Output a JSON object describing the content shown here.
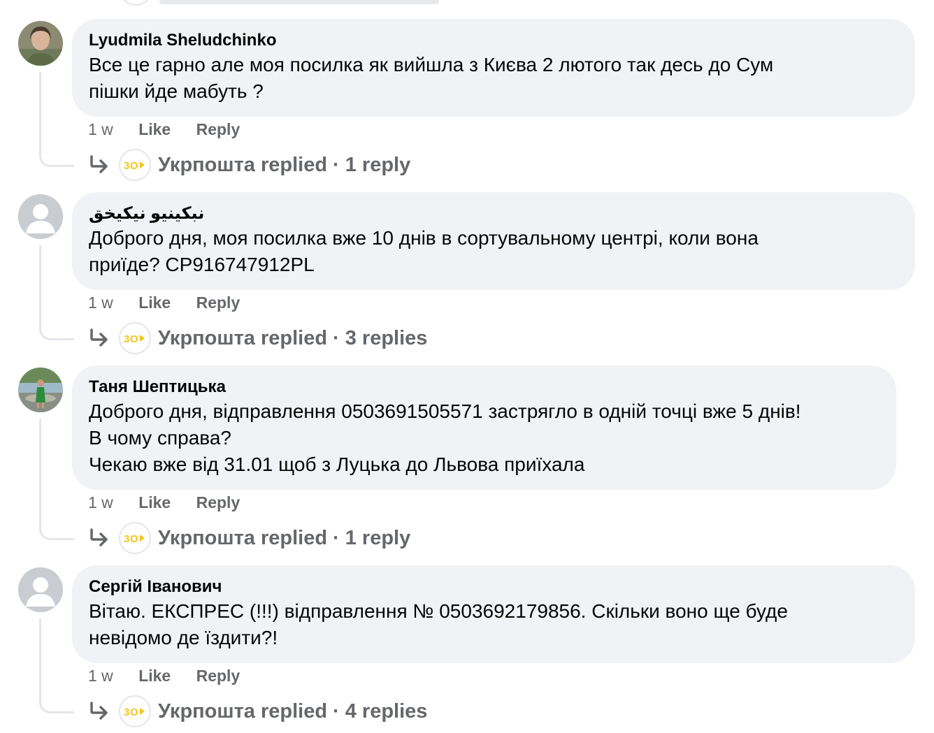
{
  "colors": {
    "bubble_bg": "#f0f2f5",
    "meta_text": "#65676b",
    "brand_yellow": "#f5c518",
    "thread_line": "#e4e6eb"
  },
  "icons": {
    "reply_arrow": "reply-arrow-icon",
    "page_logo": "ukrposhta-logo"
  },
  "comments": [
    {
      "author": "Lyudmila Sheludchinko",
      "text_lines": [
        "Все це гарно але моя посилка як вийшла з Києва 2 лютого так десь до Сум",
        "пішки йде мабуть ?"
      ],
      "time": "1 w",
      "like": "Like",
      "reply": "Reply",
      "replied_by": "Укрпошта replied",
      "separator": "·",
      "reply_count": "1 reply"
    },
    {
      "author": "نبكينيو نيكيخق",
      "text_lines": [
        "Доброго дня, моя посилка вже 10 днів в сортувальному центрі, коли вона",
        "приїде? CP916747912PL"
      ],
      "time": "1 w",
      "like": "Like",
      "reply": "Reply",
      "replied_by": "Укрпошта replied",
      "separator": "·",
      "reply_count": "3 replies"
    },
    {
      "author": "Таня Шептицька",
      "text_lines": [
        "Доброго дня, відправлення 0503691505571 застрягло в одній точці вже 5 днів!",
        "В чому справа?",
        "Чекаю вже від 31.01 щоб з Луцька до Львова приїхала"
      ],
      "time": "1 w",
      "like": "Like",
      "reply": "Reply",
      "replied_by": "Укрпошта replied",
      "separator": "·",
      "reply_count": "1 reply"
    },
    {
      "author": "Сергій Іванович",
      "text_lines": [
        "Вітаю. ЕКСПРЕС (!!!) відправлення № 0503692179856. Скільки воно ще буде",
        "невідомо де їздити?!"
      ],
      "time": "1 w",
      "like": "Like",
      "reply": "Reply",
      "replied_by": "Укрпошта replied",
      "separator": "·",
      "reply_count": "4 replies"
    }
  ]
}
